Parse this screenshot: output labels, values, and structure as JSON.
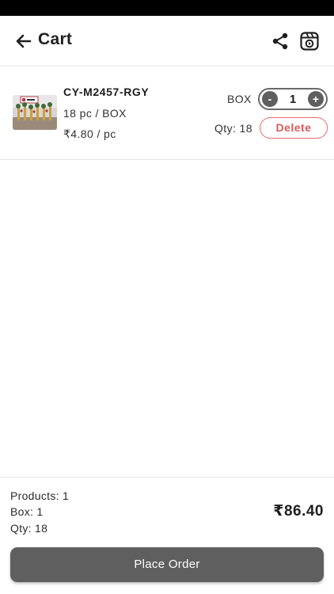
{
  "header": {
    "title": "Cart",
    "back_icon": "arrow-left-icon",
    "share_icon": "share-icon",
    "reel_icon": "video-reel-icon"
  },
  "cart_items": [
    {
      "sku": "CY-M2457-RGY",
      "pack": "18 pc / BOX",
      "price": "₹4.80 / pc",
      "unit": "BOX",
      "quantity": "1",
      "qty_text": "Qty: 18",
      "delete_label": "Delete",
      "minus_label": "-",
      "plus_label": "+"
    }
  ],
  "summary": {
    "products": "Products: 1",
    "box": "Box: 1",
    "qty": "Qty: 18",
    "total": "₹86.40"
  },
  "actions": {
    "place_order": "Place Order"
  },
  "colors": {
    "accent": "#5f5f5f",
    "delete": "#e05a5a",
    "status_bar": "#000000"
  }
}
